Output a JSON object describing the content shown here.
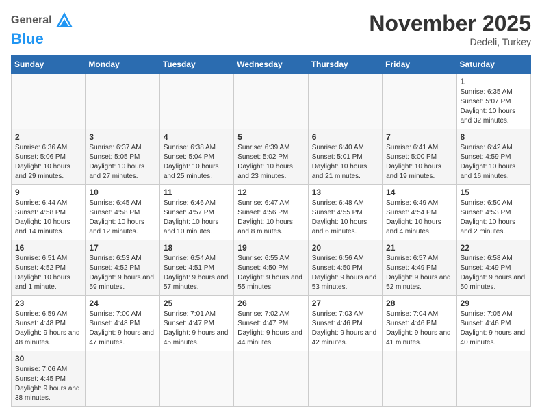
{
  "logo": {
    "general": "General",
    "blue": "Blue"
  },
  "header": {
    "month": "November 2025",
    "location": "Dedeli, Turkey"
  },
  "weekdays": [
    "Sunday",
    "Monday",
    "Tuesday",
    "Wednesday",
    "Thursday",
    "Friday",
    "Saturday"
  ],
  "weeks": [
    [
      {
        "day": "",
        "info": ""
      },
      {
        "day": "",
        "info": ""
      },
      {
        "day": "",
        "info": ""
      },
      {
        "day": "",
        "info": ""
      },
      {
        "day": "",
        "info": ""
      },
      {
        "day": "",
        "info": ""
      },
      {
        "day": "1",
        "info": "Sunrise: 6:35 AM\nSunset: 5:07 PM\nDaylight: 10 hours and 32 minutes."
      }
    ],
    [
      {
        "day": "2",
        "info": "Sunrise: 6:36 AM\nSunset: 5:06 PM\nDaylight: 10 hours and 29 minutes."
      },
      {
        "day": "3",
        "info": "Sunrise: 6:37 AM\nSunset: 5:05 PM\nDaylight: 10 hours and 27 minutes."
      },
      {
        "day": "4",
        "info": "Sunrise: 6:38 AM\nSunset: 5:04 PM\nDaylight: 10 hours and 25 minutes."
      },
      {
        "day": "5",
        "info": "Sunrise: 6:39 AM\nSunset: 5:02 PM\nDaylight: 10 hours and 23 minutes."
      },
      {
        "day": "6",
        "info": "Sunrise: 6:40 AM\nSunset: 5:01 PM\nDaylight: 10 hours and 21 minutes."
      },
      {
        "day": "7",
        "info": "Sunrise: 6:41 AM\nSunset: 5:00 PM\nDaylight: 10 hours and 19 minutes."
      },
      {
        "day": "8",
        "info": "Sunrise: 6:42 AM\nSunset: 4:59 PM\nDaylight: 10 hours and 16 minutes."
      }
    ],
    [
      {
        "day": "9",
        "info": "Sunrise: 6:44 AM\nSunset: 4:58 PM\nDaylight: 10 hours and 14 minutes."
      },
      {
        "day": "10",
        "info": "Sunrise: 6:45 AM\nSunset: 4:58 PM\nDaylight: 10 hours and 12 minutes."
      },
      {
        "day": "11",
        "info": "Sunrise: 6:46 AM\nSunset: 4:57 PM\nDaylight: 10 hours and 10 minutes."
      },
      {
        "day": "12",
        "info": "Sunrise: 6:47 AM\nSunset: 4:56 PM\nDaylight: 10 hours and 8 minutes."
      },
      {
        "day": "13",
        "info": "Sunrise: 6:48 AM\nSunset: 4:55 PM\nDaylight: 10 hours and 6 minutes."
      },
      {
        "day": "14",
        "info": "Sunrise: 6:49 AM\nSunset: 4:54 PM\nDaylight: 10 hours and 4 minutes."
      },
      {
        "day": "15",
        "info": "Sunrise: 6:50 AM\nSunset: 4:53 PM\nDaylight: 10 hours and 2 minutes."
      }
    ],
    [
      {
        "day": "16",
        "info": "Sunrise: 6:51 AM\nSunset: 4:52 PM\nDaylight: 10 hours and 1 minute."
      },
      {
        "day": "17",
        "info": "Sunrise: 6:53 AM\nSunset: 4:52 PM\nDaylight: 9 hours and 59 minutes."
      },
      {
        "day": "18",
        "info": "Sunrise: 6:54 AM\nSunset: 4:51 PM\nDaylight: 9 hours and 57 minutes."
      },
      {
        "day": "19",
        "info": "Sunrise: 6:55 AM\nSunset: 4:50 PM\nDaylight: 9 hours and 55 minutes."
      },
      {
        "day": "20",
        "info": "Sunrise: 6:56 AM\nSunset: 4:50 PM\nDaylight: 9 hours and 53 minutes."
      },
      {
        "day": "21",
        "info": "Sunrise: 6:57 AM\nSunset: 4:49 PM\nDaylight: 9 hours and 52 minutes."
      },
      {
        "day": "22",
        "info": "Sunrise: 6:58 AM\nSunset: 4:49 PM\nDaylight: 9 hours and 50 minutes."
      }
    ],
    [
      {
        "day": "23",
        "info": "Sunrise: 6:59 AM\nSunset: 4:48 PM\nDaylight: 9 hours and 48 minutes."
      },
      {
        "day": "24",
        "info": "Sunrise: 7:00 AM\nSunset: 4:48 PM\nDaylight: 9 hours and 47 minutes."
      },
      {
        "day": "25",
        "info": "Sunrise: 7:01 AM\nSunset: 4:47 PM\nDaylight: 9 hours and 45 minutes."
      },
      {
        "day": "26",
        "info": "Sunrise: 7:02 AM\nSunset: 4:47 PM\nDaylight: 9 hours and 44 minutes."
      },
      {
        "day": "27",
        "info": "Sunrise: 7:03 AM\nSunset: 4:46 PM\nDaylight: 9 hours and 42 minutes."
      },
      {
        "day": "28",
        "info": "Sunrise: 7:04 AM\nSunset: 4:46 PM\nDaylight: 9 hours and 41 minutes."
      },
      {
        "day": "29",
        "info": "Sunrise: 7:05 AM\nSunset: 4:46 PM\nDaylight: 9 hours and 40 minutes."
      }
    ],
    [
      {
        "day": "30",
        "info": "Sunrise: 7:06 AM\nSunset: 4:45 PM\nDaylight: 9 hours and 38 minutes."
      },
      {
        "day": "",
        "info": ""
      },
      {
        "day": "",
        "info": ""
      },
      {
        "day": "",
        "info": ""
      },
      {
        "day": "",
        "info": ""
      },
      {
        "day": "",
        "info": ""
      },
      {
        "day": "",
        "info": ""
      }
    ]
  ]
}
